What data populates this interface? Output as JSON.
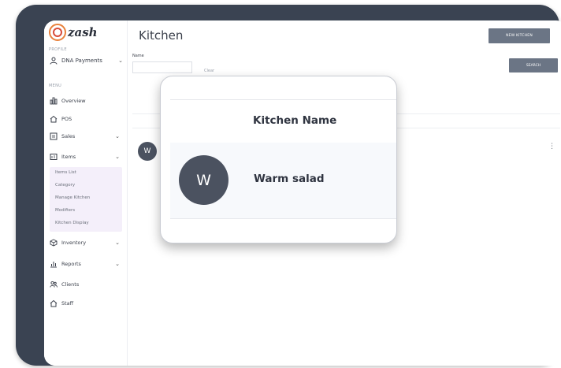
{
  "app": {
    "logo_text": "zash",
    "page_title": "Kitchen"
  },
  "sidebar": {
    "section_business": "PROFILE",
    "business_name": "DNA Payments",
    "section_menu": "MENU",
    "items": [
      {
        "label": "Overview",
        "icon": "overview-icon"
      },
      {
        "label": "POS",
        "icon": "home-icon"
      },
      {
        "label": "Sales",
        "icon": "sales-icon"
      },
      {
        "label": "Items",
        "icon": "items-icon"
      }
    ],
    "sub_items": [
      "Items List",
      "Category",
      "Manage Kitchen",
      "Modifiers",
      "Kitchen Display"
    ],
    "more_items": [
      {
        "label": "Inventory",
        "icon": "inventory-icon"
      },
      {
        "label": "Reports",
        "icon": "reports-icon"
      },
      {
        "label": "Clients",
        "icon": "clients-icon"
      },
      {
        "label": "Staff",
        "icon": "staff-icon"
      }
    ]
  },
  "toolbar": {
    "new_kitchen_label": "NEW KITCHEN",
    "search_label": "SEARCH"
  },
  "filters": {
    "name_label": "Name",
    "name_value": "",
    "clear_label": "Clear"
  },
  "table": {
    "header_partial": "Ki",
    "row_avatar": "W",
    "row_partial": "W"
  },
  "popup": {
    "column_header": "Kitchen Name",
    "avatar_letter": "W",
    "kitchen_name": "Warm salad"
  },
  "colors": {
    "button": "#6b7585",
    "avatar": "#4b5260",
    "submenu_bg": "#f4effa",
    "frame": "#3a4352"
  }
}
